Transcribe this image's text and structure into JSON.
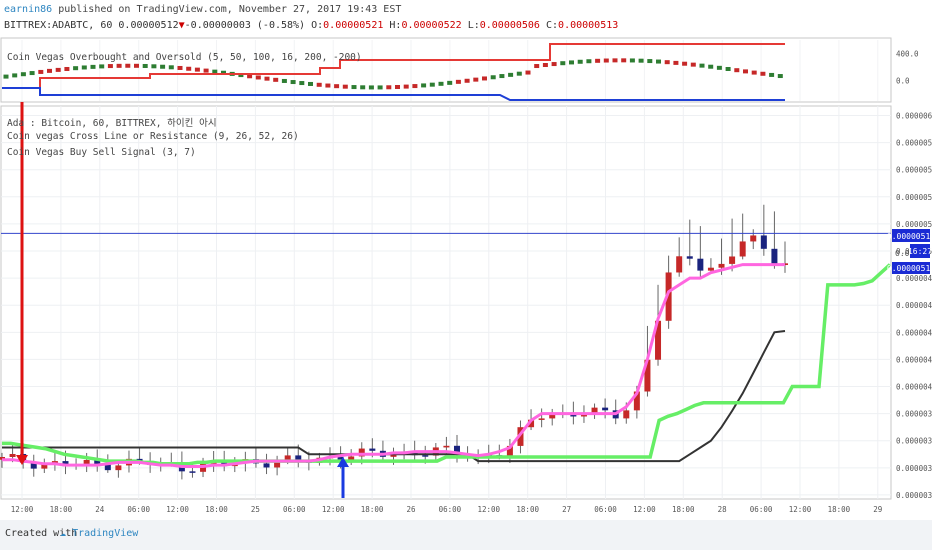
{
  "header": {
    "author": "earnin86",
    "published_text": "published on TradingView.com, November 27, 2017 19:43 EST",
    "symbol": "BITTREX:ADABTC, 60",
    "last": "0.00000512",
    "change_arrow": "▼",
    "change": "-0.00000003 (-0.58%)",
    "o_label": "O:",
    "o_value": "0.00000521",
    "h_label": "H:",
    "h_value": "0.00000522",
    "l_label": "L:",
    "l_value": "0.00000506",
    "c_label": "C:",
    "c_value": "0.00000513"
  },
  "indicators": {
    "top_pane_label": "Coin Vegas Overbought and Oversold (5, 50, 100, 16, 200, -200)",
    "main_label_1": "Ada : Bitcoin, 60, BITTREX, 하이킨 아시",
    "main_label_2": "Coin vegas Cross Line or Resistance (9, 26, 52, 26)",
    "main_label_3": "Coin Vegas Buy Sell Signal (3, 7)"
  },
  "price_badges": {
    "last_price": "0.00000513",
    "countdown": "16:27",
    "hidden_price": "0.000",
    "current_price": "0.00000512"
  },
  "footer": {
    "created_with": "Created with",
    "brand": "TradingView"
  },
  "colors": {
    "up_candle": "#2e7d32",
    "down_candle": "#c62828",
    "blue_candle": "#1a237e",
    "obos_upper": "#e53935",
    "obos_lower": "#1e3fd6",
    "signal_line": "#ff66e0",
    "resistance_line": "#333333",
    "green_line": "#66ee66",
    "last_price_line": "#3344cc"
  },
  "chart_data": [
    {
      "type": "line",
      "title": "Coin Vegas Overbought and Oversold (5, 50, 100, 16, 200, -200)",
      "y_ticks": [
        "400.0",
        "0.0"
      ],
      "ylim": [
        -300,
        600
      ],
      "series": [
        {
          "name": "upper",
          "values": [
            -100,
            -100,
            -100,
            -100,
            -100,
            -100,
            -100,
            -100,
            -100,
            -100,
            -100,
            -100,
            -100,
            -100,
            -100,
            -100,
            -100,
            -100,
            -100,
            -100,
            -100,
            -100,
            -100,
            -100,
            -100,
            -100,
            -100,
            -100,
            -100,
            -100,
            -100,
            -100,
            -100,
            -100,
            -100,
            -100,
            -100,
            -100,
            -100,
            -100,
            -100,
            -100,
            -100,
            -100,
            -100,
            -100,
            -100,
            -100,
            -100,
            -100,
            -100,
            -100,
            -100,
            -100,
            -100,
            -100,
            -100,
            -100,
            -100,
            -100,
            -100,
            -100,
            -100,
            -100,
            -100,
            -100,
            -100,
            -100,
            -100,
            -100,
            -100,
            -100
          ]
        }
      ]
    },
    {
      "type": "line",
      "title": "Ada : Bitcoin, 60, BITTREX, 하이킨 아시",
      "x_tick_labels": [
        "12:00",
        "18:00",
        "24",
        "06:00",
        "12:00",
        "18:00",
        "25",
        "06:00",
        "12:00",
        "18:00",
        "26",
        "06:00",
        "12:00",
        "18:00",
        "27",
        "06:00",
        "12:00",
        "18:00",
        "28",
        "06:00",
        "12:00",
        "18:00",
        "29"
      ],
      "y_tick_labels": [
        "0.00000600",
        "0.00000580",
        "0.00000560",
        "0.00000540",
        "0.00000520",
        "0.00000500",
        "0.00000480",
        "0.00000460",
        "0.00000440",
        "0.00000420",
        "0.00000400",
        "0.00000380",
        "0.00000360",
        "0.00000340",
        "0.00000320"
      ],
      "ylim": [
        3.17e-06,
        6.07e-06
      ],
      "grid": true,
      "series": [
        {
          "name": "Buy Sell Signal",
          "values": [
            346,
            346,
            345,
            344,
            343,
            343,
            342,
            342,
            342,
            342,
            343,
            344,
            344,
            344,
            343,
            342,
            342,
            341,
            341,
            341,
            342,
            342,
            343,
            344,
            345,
            345,
            345,
            345,
            345,
            345,
            346,
            348,
            349,
            350,
            350,
            350,
            350,
            351,
            351,
            352,
            352,
            352,
            352,
            351,
            350,
            349,
            350,
            352,
            355,
            365,
            375,
            380,
            380,
            380,
            380,
            380,
            380,
            380,
            380,
            385,
            395,
            420,
            450,
            470,
            475,
            480,
            480,
            484,
            486,
            488,
            490,
            490,
            490,
            490,
            490
          ]
        },
        {
          "name": "Cross Line or Resistance",
          "values": [
            355,
            355,
            355,
            355,
            355,
            355,
            355,
            355,
            355,
            355,
            355,
            355,
            355,
            355,
            355,
            355,
            355,
            355,
            355,
            355,
            355,
            355,
            355,
            355,
            355,
            355,
            355,
            355,
            355,
            350,
            350,
            350,
            350,
            350,
            350,
            350,
            350,
            350,
            350,
            350,
            350,
            350,
            350,
            350,
            350,
            345,
            345,
            345,
            345,
            345,
            345,
            345,
            345,
            345,
            345,
            345,
            345,
            345,
            345,
            345,
            345,
            345,
            345,
            345,
            345,
            350,
            355,
            360,
            370,
            382,
            395,
            410,
            425,
            440,
            441
          ]
        },
        {
          "name": "Green Line",
          "values": [
            358,
            358,
            357,
            356,
            355,
            354,
            352,
            350,
            349,
            348,
            347,
            346,
            345,
            345,
            345,
            345,
            344,
            344,
            343,
            343,
            343,
            343,
            344,
            344,
            345,
            345,
            345,
            345,
            345,
            345,
            345,
            345,
            345,
            345,
            345,
            345,
            345,
            345,
            345,
            345,
            345,
            345,
            345,
            345,
            345,
            345,
            345,
            345,
            345,
            345,
            348,
            348,
            348,
            348,
            348,
            348,
            348,
            348,
            348,
            348,
            348,
            348,
            348,
            348,
            348,
            348,
            348,
            348,
            348,
            348,
            348,
            348,
            348,
            348,
            375,
            378,
            380,
            383,
            386,
            388,
            388,
            388,
            388,
            388,
            388,
            388,
            388,
            388,
            388,
            400,
            400,
            400,
            400,
            475,
            475,
            475,
            475,
            476,
            478,
            484,
            490
          ]
        },
        {
          "name": "Last Price",
          "values": [
            513
          ]
        }
      ]
    }
  ]
}
